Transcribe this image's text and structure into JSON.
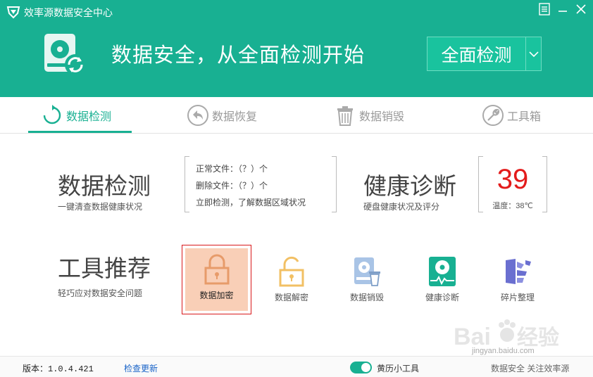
{
  "window": {
    "title": "效率源数据安全中心",
    "menu_icon": "menu-icon",
    "minimize_icon": "minimize-icon",
    "close_icon": "close-icon"
  },
  "hero": {
    "headline": "数据安全，从全面检测开始",
    "scan_button": "全面检测"
  },
  "tabs": [
    {
      "label": "数据检测",
      "icon": "refresh-circle-icon",
      "active": true
    },
    {
      "label": "数据恢复",
      "icon": "undo-arrow-icon",
      "active": false
    },
    {
      "label": "数据销毁",
      "icon": "trash-icon",
      "active": false
    },
    {
      "label": "工具箱",
      "icon": "wrench-icon",
      "active": false
    }
  ],
  "detect": {
    "title": "数据检测",
    "subtitle": "一键清查数据健康状况",
    "normal_files": "正常文件：（？）个",
    "deleted_files": "删除文件：（？）个",
    "hint": "立即检测，了解数据区域状况"
  },
  "health": {
    "title": "健康诊断",
    "subtitle": "硬盘健康状况及评分",
    "score": "39",
    "temperature": "温度：38℃"
  },
  "tools": {
    "title": "工具推荐",
    "subtitle": "轻巧应对数据安全问题",
    "items": [
      {
        "label": "数据加密",
        "icon": "lock-closed-icon"
      },
      {
        "label": "数据解密",
        "icon": "lock-open-icon"
      },
      {
        "label": "数据销毁",
        "icon": "disk-trash-icon"
      },
      {
        "label": "健康诊断",
        "icon": "disk-pulse-icon"
      },
      {
        "label": "碎片整理",
        "icon": "defrag-icon"
      }
    ]
  },
  "footer": {
    "version": "版本：1.0.4.421",
    "check_update": "检查更新",
    "calendar_tool": "黄历小工具",
    "slogan": "数据安全 关注效率源"
  },
  "watermark": {
    "text": "jingyan.baidu.com"
  },
  "colors": {
    "brand": "#18b092",
    "score": "#e31b1b",
    "selected_tool_bg": "#f9cfb7"
  }
}
